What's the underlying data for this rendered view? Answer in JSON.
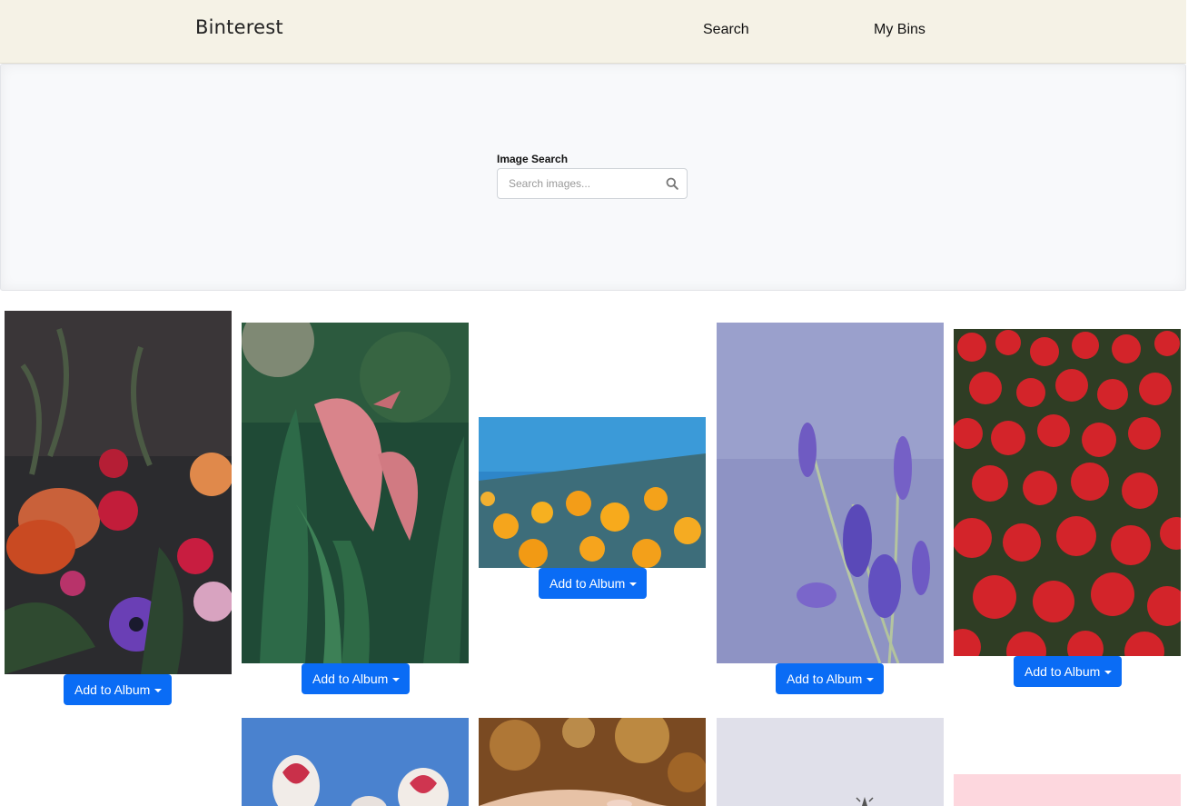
{
  "app": {
    "brand": "Binterest"
  },
  "nav": {
    "items": [
      {
        "label": "Search"
      },
      {
        "label": "My Bins"
      }
    ]
  },
  "search": {
    "label": "Image Search",
    "placeholder": "Search images...",
    "value": ""
  },
  "cards": {
    "button_label": "Add to Album",
    "items": [
      {
        "subject": "bouquet with red roses and purple anemone"
      },
      {
        "subject": "pink calla lilies"
      },
      {
        "subject": "orange poppies under blue sky"
      },
      {
        "subject": "purple lavender"
      },
      {
        "subject": "field of red begonias"
      },
      {
        "subject": "red and white tulips"
      },
      {
        "subject": "hand with blurred autumn bokeh"
      },
      {
        "subject": "pale lavender sky with plant"
      },
      {
        "subject": "pink background"
      }
    ]
  }
}
